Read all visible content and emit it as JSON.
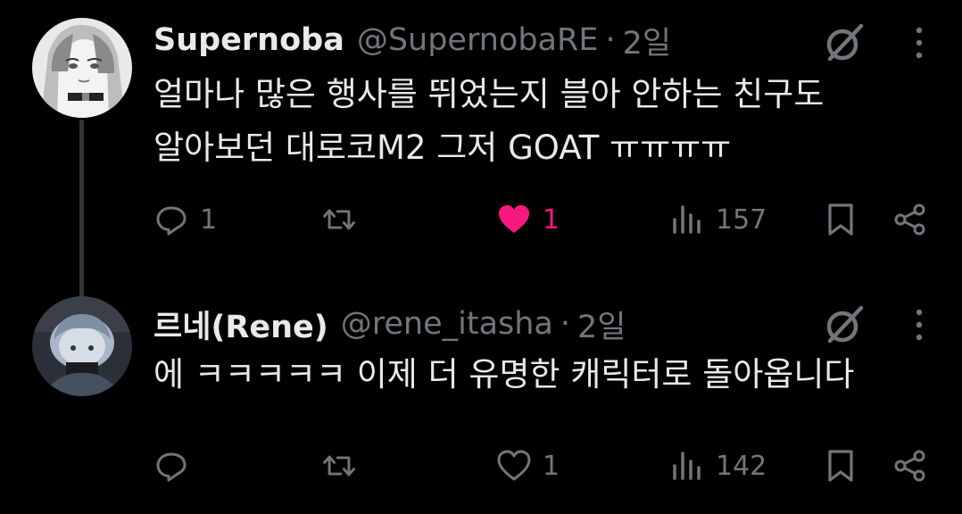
{
  "tweets": [
    {
      "display_name": "Supernoba",
      "handle": "@SupernobaRE",
      "separator": "·",
      "time": "2일",
      "text_lines": [
        "얼마나 많은 행사를 뛰었는지 블아 안하는 친구도",
        "알아보던 대로코M2 그저 GOAT ㅠㅠㅠㅠ"
      ],
      "replies": "1",
      "retweets": "",
      "likes": "1",
      "liked": true,
      "views": "157"
    },
    {
      "display_name": "르네(Rene)",
      "handle": "@rene_itasha",
      "separator": "·",
      "time": "2일",
      "text_lines": [
        "에 ㅋㅋㅋㅋㅋ 이제 더 유명한 캐릭터로 돌아옵니다"
      ],
      "replies": "",
      "retweets": "",
      "likes": "1",
      "liked": false,
      "views": "142"
    }
  ],
  "colors": {
    "background": "#000000",
    "text_primary": "#e7e9ea",
    "text_secondary": "#71767b",
    "like_active": "#f91880",
    "thread_line": "#333639"
  },
  "icons": [
    "grok-icon",
    "more-icon",
    "reply-icon",
    "retweet-icon",
    "heart-icon",
    "views-icon",
    "bookmark-icon",
    "share-icon"
  ]
}
